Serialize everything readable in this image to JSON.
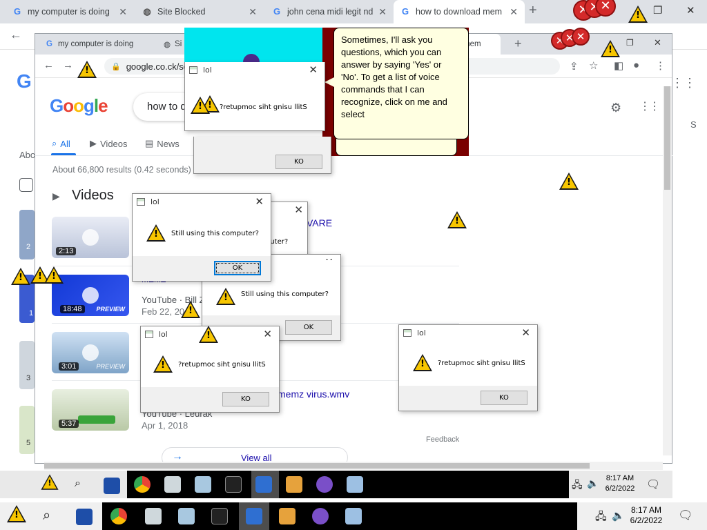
{
  "outer_browser": {
    "tabs": [
      {
        "title": "my computer is doing",
        "favicon": "google-icon",
        "active": false
      },
      {
        "title": "Site Blocked",
        "favicon": "globe-icon",
        "active": false
      },
      {
        "title": "john cena midi legit nd",
        "favicon": "google-icon",
        "active": false
      },
      {
        "title": "how to download mem",
        "favicon": "google-icon",
        "active": true
      }
    ],
    "new_tab_label": "+"
  },
  "inner_browser": {
    "tabs": [
      {
        "title": "my computer is doing",
        "favicon": "google-icon"
      },
      {
        "title": "Si",
        "favicon": "globe-icon"
      },
      {
        "title": "mem",
        "favicon": "google-icon"
      }
    ],
    "url": "google.co.ck/se"
  },
  "google": {
    "logo_letters": [
      "G",
      "o",
      "o",
      "g",
      "l",
      "e"
    ],
    "query": "how to d",
    "tabs": [
      {
        "label": "All",
        "active": true
      },
      {
        "label": "Videos",
        "active": false
      },
      {
        "label": "News",
        "active": false
      }
    ],
    "result_stats": "About 66,800 results (0.42 seconds)",
    "videos_heading": "Videos",
    "videos": [
      {
        "duration": "2:13",
        "link": "VARE"
      },
      {
        "duration": "18:48",
        "badge": "PREVIEW",
        "title_fragment": "MEMZ",
        "source": "YouTube · Bill Z",
        "date": "Feb 22, 20"
      },
      {
        "duration": "3:01",
        "badge": "PREVIEW"
      },
      {
        "duration": "5:37",
        "link": "memz virus.wmv",
        "source": "YouTube · Leurak",
        "date": "Apr 1, 2018"
      }
    ],
    "feedback": "Feedback",
    "view_all": "View all",
    "outer_left_fragments": [
      "G",
      "Abo",
      "2",
      "1",
      "3",
      "5"
    ],
    "right_fragment": "S"
  },
  "balloon": {
    "text": "Sometimes, I'll ask you questions, which you can answer by saying 'Yes' or 'No'. To get a list of voice commands that I can recognize, click on me and select"
  },
  "dialogs": [
    {
      "title": "lol",
      "message": "?retupmoc siht gnisu llitS",
      "button": "KO"
    },
    {
      "title": "lol",
      "message": "Still using this computer?",
      "button": "OK"
    },
    {
      "title": "",
      "message": "puter?",
      "button": "OK"
    },
    {
      "title": "",
      "message": "Still using this computer?",
      "button": "OK"
    },
    {
      "title": "lol",
      "message": "?retupmoc siht gnisu llitS",
      "button": "KO"
    },
    {
      "title": "lol",
      "message": "?retupmoc siht gnisu llitS",
      "button": "KO"
    }
  ],
  "taskbar_inner": {
    "time": "8:17 AM",
    "date": "6/2/2022"
  },
  "taskbar_outer": {
    "time": "8:17 AM",
    "date": "6/2/2022"
  },
  "colors": {
    "google_blue": "#1a73e8",
    "link": "#1a0dab",
    "warning_yellow": "#f7c600",
    "balloon_bg": "#ffffe1"
  }
}
